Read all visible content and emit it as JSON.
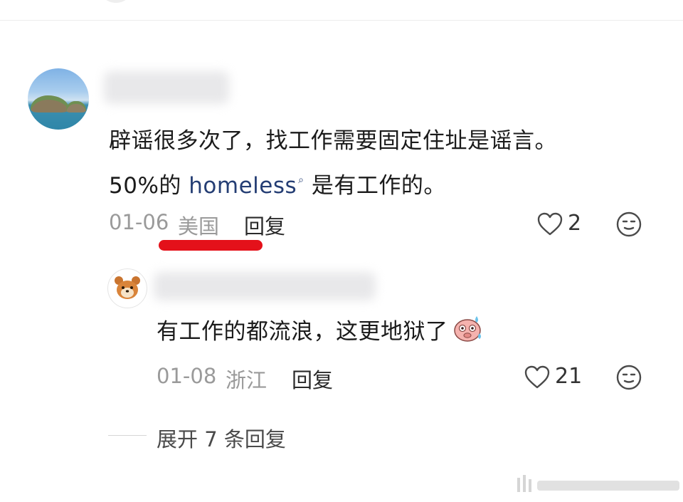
{
  "comment": {
    "text_line1": "辟谣很多次了，找工作需要固定住址是谣言。",
    "text_line2_prefix": "50%的 ",
    "link_text": "homeless",
    "text_line2_suffix": " 是有工作的。",
    "date": "01-06",
    "location": "美国",
    "reply_label": "回复",
    "like_count": "2"
  },
  "reply": {
    "text": "有工作的都流浪，这更地狱了",
    "date": "01-08",
    "location": "浙江",
    "reply_label": "回复",
    "like_count": "21"
  },
  "expand": {
    "label": "展开 7 条回复"
  },
  "icons": {
    "like": "heart-outline-icon",
    "react": "emoji-face-icon",
    "link": "search-icon",
    "sticker": "sweating-pig-emoji",
    "reply_avatar": "hamster-icon"
  },
  "colors": {
    "highlight_underline": "#e4111a",
    "link": "#253e74"
  }
}
